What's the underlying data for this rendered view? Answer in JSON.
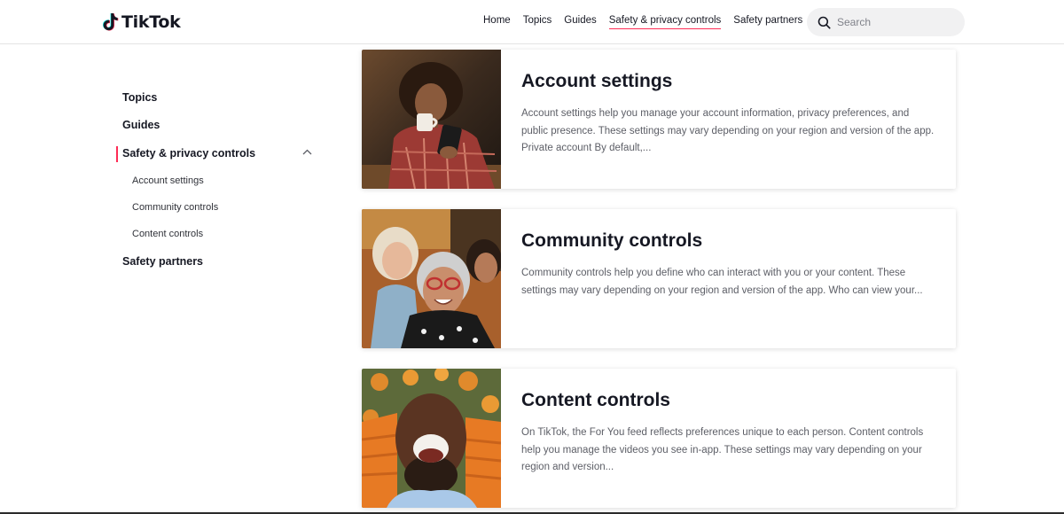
{
  "header": {
    "logo_text": "TikTok",
    "nav": [
      {
        "label": "Home",
        "active": false
      },
      {
        "label": "Topics",
        "active": false
      },
      {
        "label": "Guides",
        "active": false
      },
      {
        "label": "Safety & privacy controls",
        "active": true
      },
      {
        "label": "Safety partners",
        "active": false
      }
    ],
    "search_placeholder": "Search"
  },
  "sidebar": {
    "topics": "Topics",
    "guides": "Guides",
    "safety_privacy": "Safety & privacy controls",
    "sub_items": [
      "Account settings",
      "Community controls",
      "Content controls"
    ],
    "safety_partners": "Safety partners"
  },
  "cards": [
    {
      "title": "Account settings",
      "description": "Account settings help you manage your account information, privacy preferences, and public presence. These settings may vary depending on your region and version of the app. Private account By default,..."
    },
    {
      "title": "Community controls",
      "description": "Community controls help you define who can interact with you or your content. These settings may vary depending on your region and version of the app. Who can view your..."
    },
    {
      "title": "Content controls",
      "description": "On TikTok, the For You feed reflects preferences unique to each person. Content controls help you manage the videos you see in-app. These settings may vary depending on your region and version..."
    }
  ],
  "colors": {
    "accent": "#fe2c55",
    "text": "#161823",
    "muted": "#5c5e66"
  }
}
